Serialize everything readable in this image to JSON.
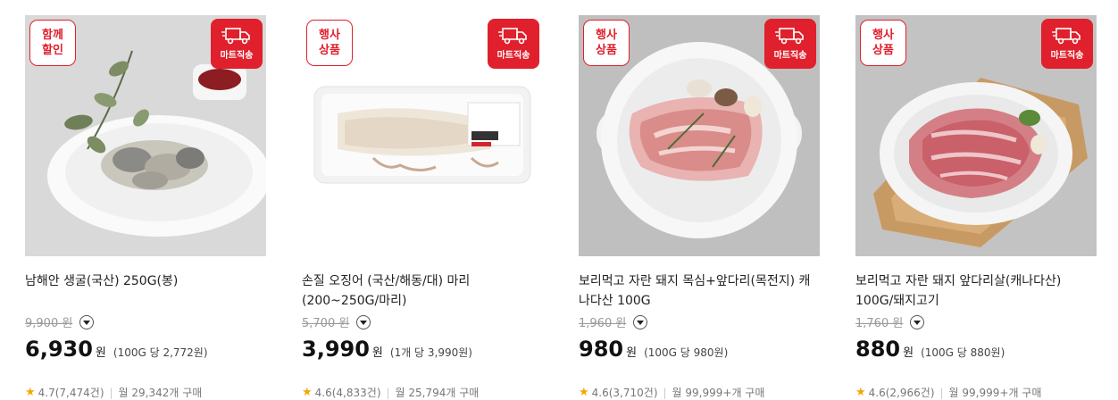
{
  "products": [
    {
      "badge": "함께 할인",
      "delivery_badge": "마트직송",
      "truck_icon": "delivery-truck-icon",
      "title": "남해안 생굴(국산) 250G(봉)",
      "original_price": "9,900 원",
      "price": "6,930",
      "currency": "원",
      "unit_price": "(100G 당 2,772원)",
      "rating": "4.7(7,474건)",
      "monthly_purchases": "월 29,342개 구매"
    },
    {
      "badge": "행사 상품",
      "delivery_badge": "마트직송",
      "truck_icon": "delivery-truck-icon",
      "title": "손질 오징어 (국산/해동/대) 마리(200~250G/마리)",
      "original_price": "5,700 원",
      "price": "3,990",
      "currency": "원",
      "unit_price": "(1개 당 3,990원)",
      "rating": "4.6(4,833건)",
      "monthly_purchases": "월 25,794개 구매"
    },
    {
      "badge": "행사 상품",
      "delivery_badge": "마트직송",
      "truck_icon": "delivery-truck-icon",
      "title": "보리먹고 자란 돼지 목심+앞다리(목전지) 캐나다산 100G",
      "original_price": "1,960 원",
      "price": "980",
      "currency": "원",
      "unit_price": "(100G 당 980원)",
      "rating": "4.6(3,710건)",
      "monthly_purchases": "월 99,999+개 구매"
    },
    {
      "badge": "행사 상품",
      "delivery_badge": "마트직송",
      "truck_icon": "delivery-truck-icon",
      "title": "보리먹고 자란 돼지 앞다리살(캐나다산) 100G/돼지고기",
      "original_price": "1,760 원",
      "price": "880",
      "currency": "원",
      "unit_price": "(100G 당 880원)",
      "rating": "4.6(2,966건)",
      "monthly_purchases": "월 99,999+개 구매"
    }
  ],
  "colors": {
    "badge_red": "#e0202c",
    "star": "#f5a700"
  }
}
